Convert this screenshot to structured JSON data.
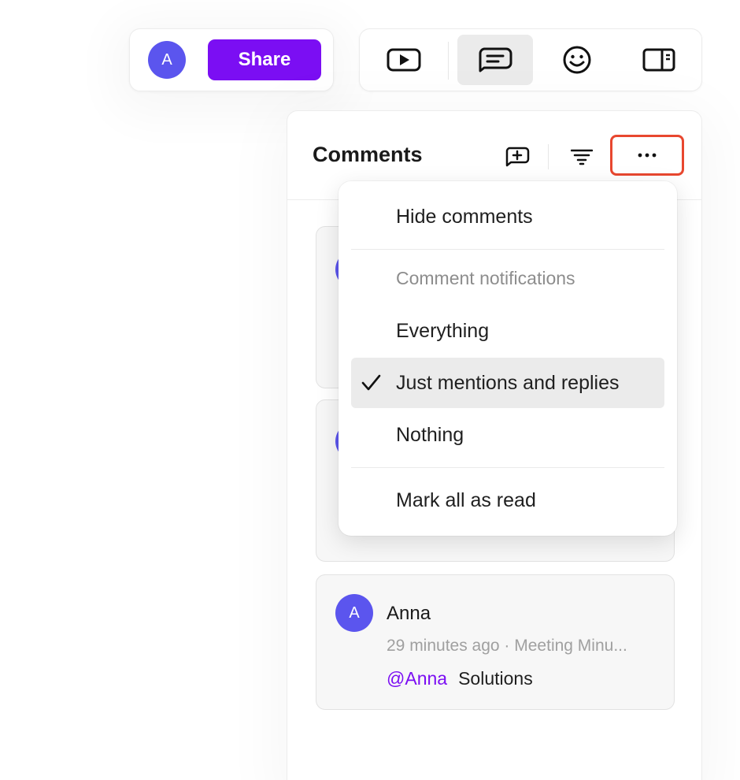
{
  "topbar": {
    "avatar_initial": "A",
    "share_label": "Share",
    "tools": [
      {
        "name": "presentation-icon",
        "active": false
      },
      {
        "name": "comments-icon",
        "active": true
      },
      {
        "name": "emoji-icon",
        "active": false
      },
      {
        "name": "sidebar-panel-icon",
        "active": false
      }
    ]
  },
  "panel": {
    "title": "Comments",
    "actions": [
      "add-comment-icon",
      "filter-icon",
      "more-icon"
    ]
  },
  "comments": [
    {
      "author": "Anna",
      "avatar_initial": "A",
      "time": "29 minutes ago",
      "source": "Meeting Minu...",
      "meta": "29 minutes ago · Meeting Minu...",
      "mention": "@Anna",
      "text": "Solutions"
    }
  ],
  "menu": {
    "hide_comments": "Hide comments",
    "section_label": "Comment notifications",
    "options": [
      "Everything",
      "Just mentions and replies",
      "Nothing"
    ],
    "selected_option": "Just mentions and replies",
    "mark_all_read": "Mark all as read"
  },
  "colors": {
    "accent": "#7b0ef3",
    "avatar": "#5b55ee",
    "highlight_border": "#e8472f"
  }
}
